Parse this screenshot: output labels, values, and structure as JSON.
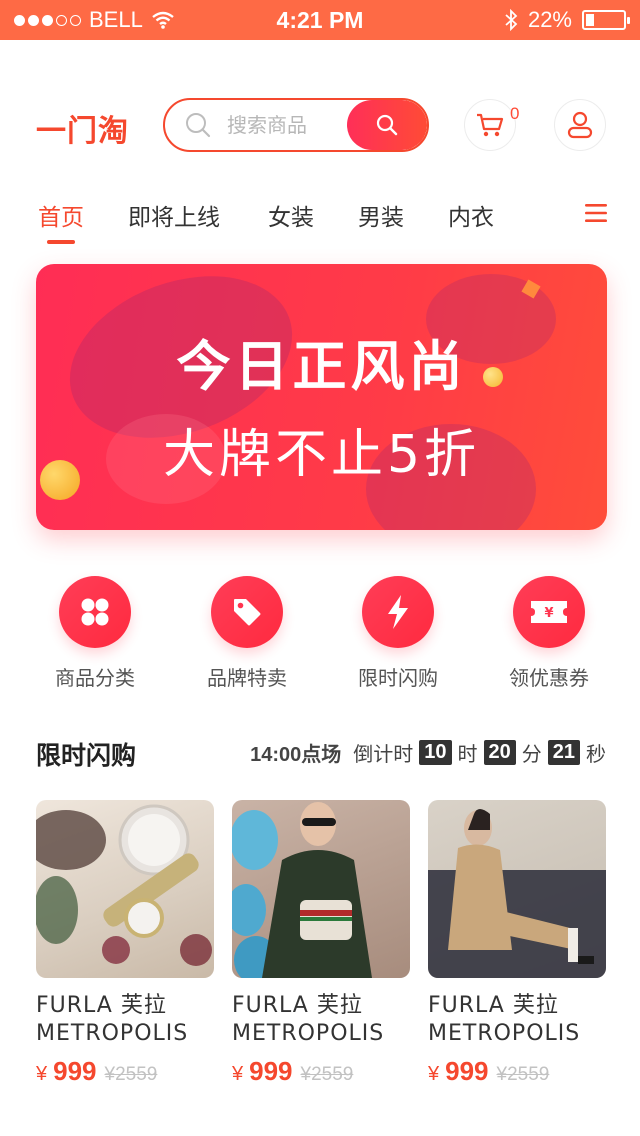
{
  "status_bar": {
    "carrier": "BELL",
    "time": "4:21 PM",
    "battery": "22%",
    "battery_level": 0.22
  },
  "header": {
    "logo": "一门淘",
    "search_placeholder": "搜索商品",
    "cart_count": "0"
  },
  "tabs": [
    {
      "label": "首页",
      "active": true
    },
    {
      "label": "即将上线",
      "active": false
    },
    {
      "label": "女装",
      "active": false
    },
    {
      "label": "男装",
      "active": false
    },
    {
      "label": "内衣",
      "active": false
    }
  ],
  "banner": {
    "title": "今日正风尚",
    "subtitle": "大牌不止5折"
  },
  "quick_links": [
    {
      "label": "商品分类",
      "icon": "category-grid-icon"
    },
    {
      "label": "品牌特卖",
      "icon": "price-tag-icon"
    },
    {
      "label": "限时闪购",
      "icon": "lightning-icon"
    },
    {
      "label": "领优惠券",
      "icon": "coupon-ticket-icon"
    }
  ],
  "flash_sale": {
    "title": "限时闪购",
    "session": "14:00点场",
    "countdown_label": "倒计时",
    "hours": "10",
    "hours_unit": "时",
    "minutes": "20",
    "minutes_unit": "分",
    "seconds": "21",
    "seconds_unit": "秒"
  },
  "products": [
    {
      "name_line1": "FURLA 芙拉",
      "name_line2": "METROPOLIS",
      "currency": "¥",
      "price": "999",
      "original_price": "¥2559",
      "image": "watch-accessories-photo"
    },
    {
      "name_line1": "FURLA 芙拉",
      "name_line2": "METROPOLIS",
      "currency": "¥",
      "price": "999",
      "original_price": "¥2559",
      "image": "model-with-handbag-photo"
    },
    {
      "name_line1": "FURLA 芙拉",
      "name_line2": "METROPOLIS",
      "currency": "¥",
      "price": "999",
      "original_price": "¥2559",
      "image": "model-trench-coat-photo"
    }
  ],
  "colors": {
    "brand": "#f5482e",
    "status_bar": "#fe6a45",
    "accent_gradient_start": "#ff2d55",
    "accent_gradient_end": "#ff4d3a"
  }
}
